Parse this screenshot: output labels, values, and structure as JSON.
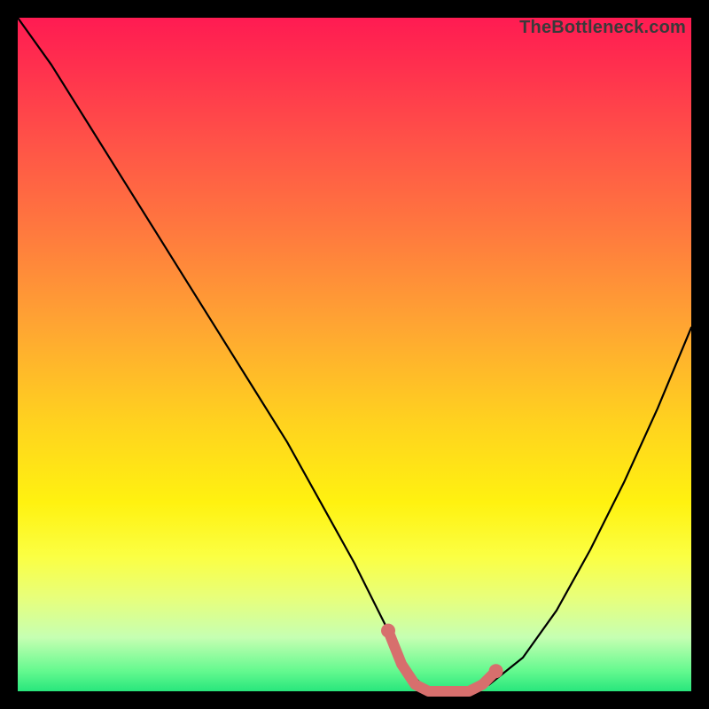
{
  "watermark": "TheBottleneck.com",
  "chart_data": {
    "type": "line",
    "title": "",
    "xlabel": "",
    "ylabel": "",
    "xlim": [
      0,
      100
    ],
    "ylim": [
      0,
      100
    ],
    "grid": false,
    "legend": false,
    "series": [
      {
        "name": "bottleneck-curve",
        "color": "#000000",
        "x": [
          0,
          5,
          10,
          15,
          20,
          25,
          30,
          35,
          40,
          45,
          50,
          55,
          57,
          59,
          61,
          63,
          65,
          67,
          70,
          75,
          80,
          85,
          90,
          95,
          100
        ],
        "y": [
          100,
          93,
          85,
          77,
          69,
          61,
          53,
          45,
          37,
          28,
          19,
          9,
          5,
          2,
          0,
          0,
          0,
          0,
          1,
          5,
          12,
          21,
          31,
          42,
          54
        ]
      },
      {
        "name": "flat-highlight",
        "color": "#d76f6d",
        "x": [
          55,
          57,
          59,
          61,
          63,
          65,
          67,
          69,
          71
        ],
        "y": [
          9,
          4,
          1,
          0,
          0,
          0,
          0,
          1,
          3
        ]
      }
    ],
    "markers": [
      {
        "name": "dot-anchor-left",
        "x": 55,
        "y": 9,
        "color": "#d76f6d"
      },
      {
        "name": "dot-anchor-right",
        "x": 71,
        "y": 3,
        "color": "#d76f6d"
      }
    ]
  }
}
